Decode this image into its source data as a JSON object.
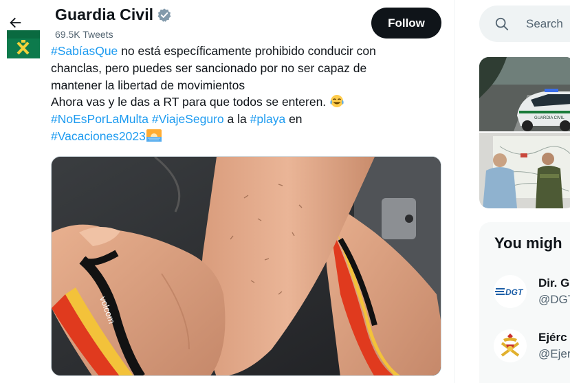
{
  "header": {
    "name": "Guardia Civil",
    "tweet_count": "69.5K Tweets",
    "follow_label": "Follow"
  },
  "tweet": {
    "line1": {
      "tag": "#SabíasQue",
      "text": " no está específicamente prohibido conducir con"
    },
    "line2": "chanclas, pero puedes ser sancionado por no ser capaz de",
    "line3": "mantener la libertad de movimientos",
    "line4": "Ahora vas y le das a RT para que todos se enteren. ",
    "line5": {
      "tag1": "#NoEsPorLaMulta",
      "sep1": " ",
      "tag2": "#ViajeSeguro",
      "mid": " a la ",
      "tag3": "#playa",
      "end": " en"
    },
    "line6": {
      "tag": "#Vacaciones2023"
    },
    "emojis": [
      "face-with-tears-of-joy",
      "sunrise-over-water"
    ]
  },
  "search": {
    "placeholder": "Search"
  },
  "who_to_follow": {
    "title": "You migh",
    "accounts": [
      {
        "name": "Dir. G",
        "handle": "@DGT",
        "logo_text": "DGT"
      },
      {
        "name": "Ejérc",
        "handle": "@Ejer"
      }
    ]
  },
  "colors": {
    "accent": "#1d9bf0",
    "text": "#0f1419",
    "secondary": "#536471",
    "follow_bg": "#0f1419"
  }
}
